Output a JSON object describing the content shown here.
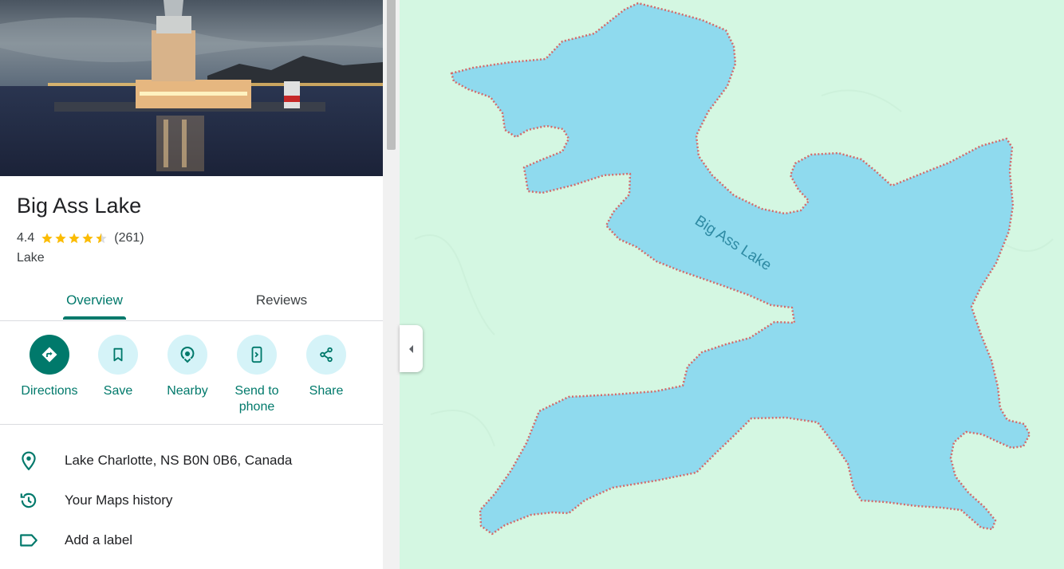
{
  "place": {
    "name": "Big Ass Lake",
    "rating": "4.4",
    "stars": 4.4,
    "review_count": "(261)",
    "category": "Lake"
  },
  "tabs": [
    {
      "label": "Overview",
      "active": true
    },
    {
      "label": "Reviews",
      "active": false
    }
  ],
  "actions": [
    {
      "label": "Directions",
      "icon": "directions-icon"
    },
    {
      "label": "Save",
      "icon": "bookmark-icon"
    },
    {
      "label": "Nearby",
      "icon": "nearby-icon"
    },
    {
      "label": "Send to phone",
      "icon": "send-to-phone-icon"
    },
    {
      "label": "Share",
      "icon": "share-icon"
    }
  ],
  "info": {
    "address": "Lake Charlotte, NS B0N 0B6, Canada",
    "history": "Your Maps history",
    "add_label": "Add a label"
  },
  "map": {
    "lake_label": "Big Ass Lake"
  },
  "colors": {
    "accent": "#00796b",
    "action_bg": "#d5f3f8",
    "star": "#fbbc04",
    "water": "#8fdaee",
    "land": "#d4f7e2",
    "boundary": "#d36b6b"
  }
}
